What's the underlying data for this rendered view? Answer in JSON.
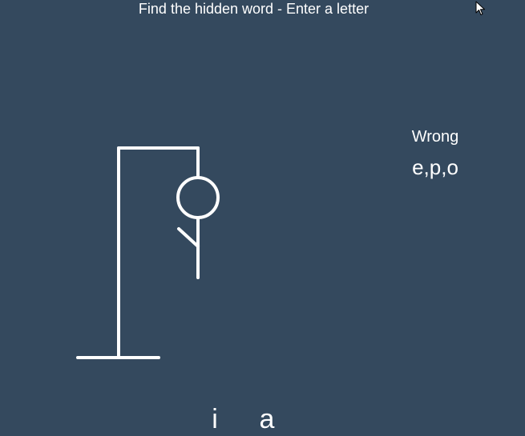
{
  "header": {
    "title": "Find the hidden word - Enter a letter"
  },
  "wrong": {
    "label": "Wrong",
    "letters": "e,p,o"
  },
  "word": {
    "revealed": [
      "i",
      "a"
    ]
  },
  "colors": {
    "background": "#34495e",
    "foreground": "#ffffff"
  },
  "icons": {
    "cursor": "mouse-pointer-icon"
  }
}
